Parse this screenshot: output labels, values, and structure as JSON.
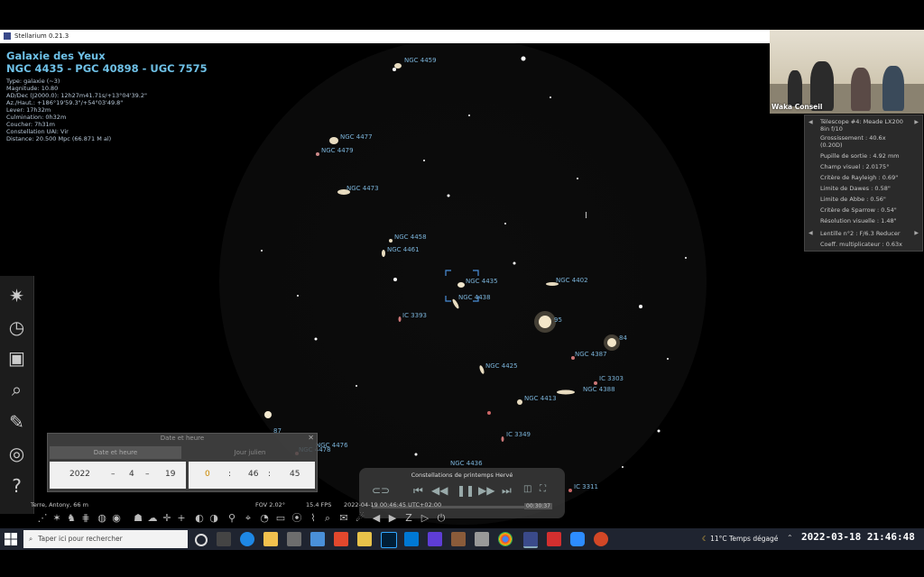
{
  "app": {
    "title": "Stellarium 0.21.3"
  },
  "object": {
    "name": "Galaxie des Yeux",
    "ids": "NGC 4435 - PGC 40898 - UGC 7575",
    "lines": [
      "Type: galaxie (~3)",
      "Magnitude: 10.80",
      "AD/Dec (J2000.0): 12h27m41.71s/+13°04'39.2\"",
      "Az./Haut.: +186°19'59.3\"/+54°03'49.8\"",
      "Lever: 17h32m",
      "Culmination: 0h32m",
      "Coucher: 7h31m",
      "Constellation UAI: Vir",
      "Distance: 20.500 Mpc (66.871 M al)"
    ]
  },
  "sky_labels": [
    {
      "text": "NGC 4459"
    },
    {
      "text": "NGC 4477"
    },
    {
      "text": "NGC 4479"
    },
    {
      "text": "NGC 4473"
    },
    {
      "text": "NGC 4458"
    },
    {
      "text": "NGC 4461"
    },
    {
      "text": "NGC 4435"
    },
    {
      "text": "NGC 4438"
    },
    {
      "text": "NGC 4402"
    },
    {
      "text": "IC 3393"
    },
    {
      "text": "95"
    },
    {
      "text": "84"
    },
    {
      "text": "NGC 4387"
    },
    {
      "text": "NGC 4425"
    },
    {
      "text": "IC 3303"
    },
    {
      "text": "NGC 4388"
    },
    {
      "text": "NGC 4413"
    },
    {
      "text": "IC 3349"
    },
    {
      "text": "NGC 4476"
    },
    {
      "text": "NGC 4478"
    },
    {
      "text": "NGC 4436"
    },
    {
      "text": "IC 3311"
    },
    {
      "text": "87"
    }
  ],
  "video": {
    "caption": "Waka Conseil"
  },
  "ocular": {
    "rows": [
      "Télescope #4: Meade LX200",
      "8in f/10",
      "Grossissement : 40.6x",
      "(0.20D)",
      "Pupille de sortie : 4.92 mm",
      "Champ visuel : 2.0175°",
      "Critère de Rayleigh : 0.69\"",
      "Limite de Dawes : 0.58\"",
      "Limite de Abbe : 0.56\"",
      "Critère de Sparrow : 0.54\"",
      "Résolution visuelle : 1.48\"",
      "Lentille n°2 : F/6.3 Reducer",
      "Coeff. multiplicateur : 0.63x"
    ]
  },
  "datetime": {
    "title": "Date et heure",
    "tab_date": "Date et heure",
    "tab_julian": "Jour julien",
    "year": "2022",
    "month": "4",
    "day": "19",
    "hour": "0",
    "minute": "46",
    "second": "45",
    "sep_date": "–",
    "sep_time": ":"
  },
  "player": {
    "title": "Constellations de printemps Hervé",
    "time": "00:30:37"
  },
  "status": {
    "location": "Terre, Antony, 66 m",
    "fov": "FOV 2.02°",
    "fps": "15.4 FPS",
    "datetime": "2022-04-19 00:46:45 UTC+02:00"
  },
  "taskbar": {
    "search_placeholder": "Taper ici pour rechercher",
    "weather": "11°C  Temps dégagé",
    "clock": "2022-03-18  21:46:48"
  },
  "colors": {
    "label": "#7ab3d9",
    "title": "#6ec0e6",
    "taskbar": "#1f2430"
  }
}
